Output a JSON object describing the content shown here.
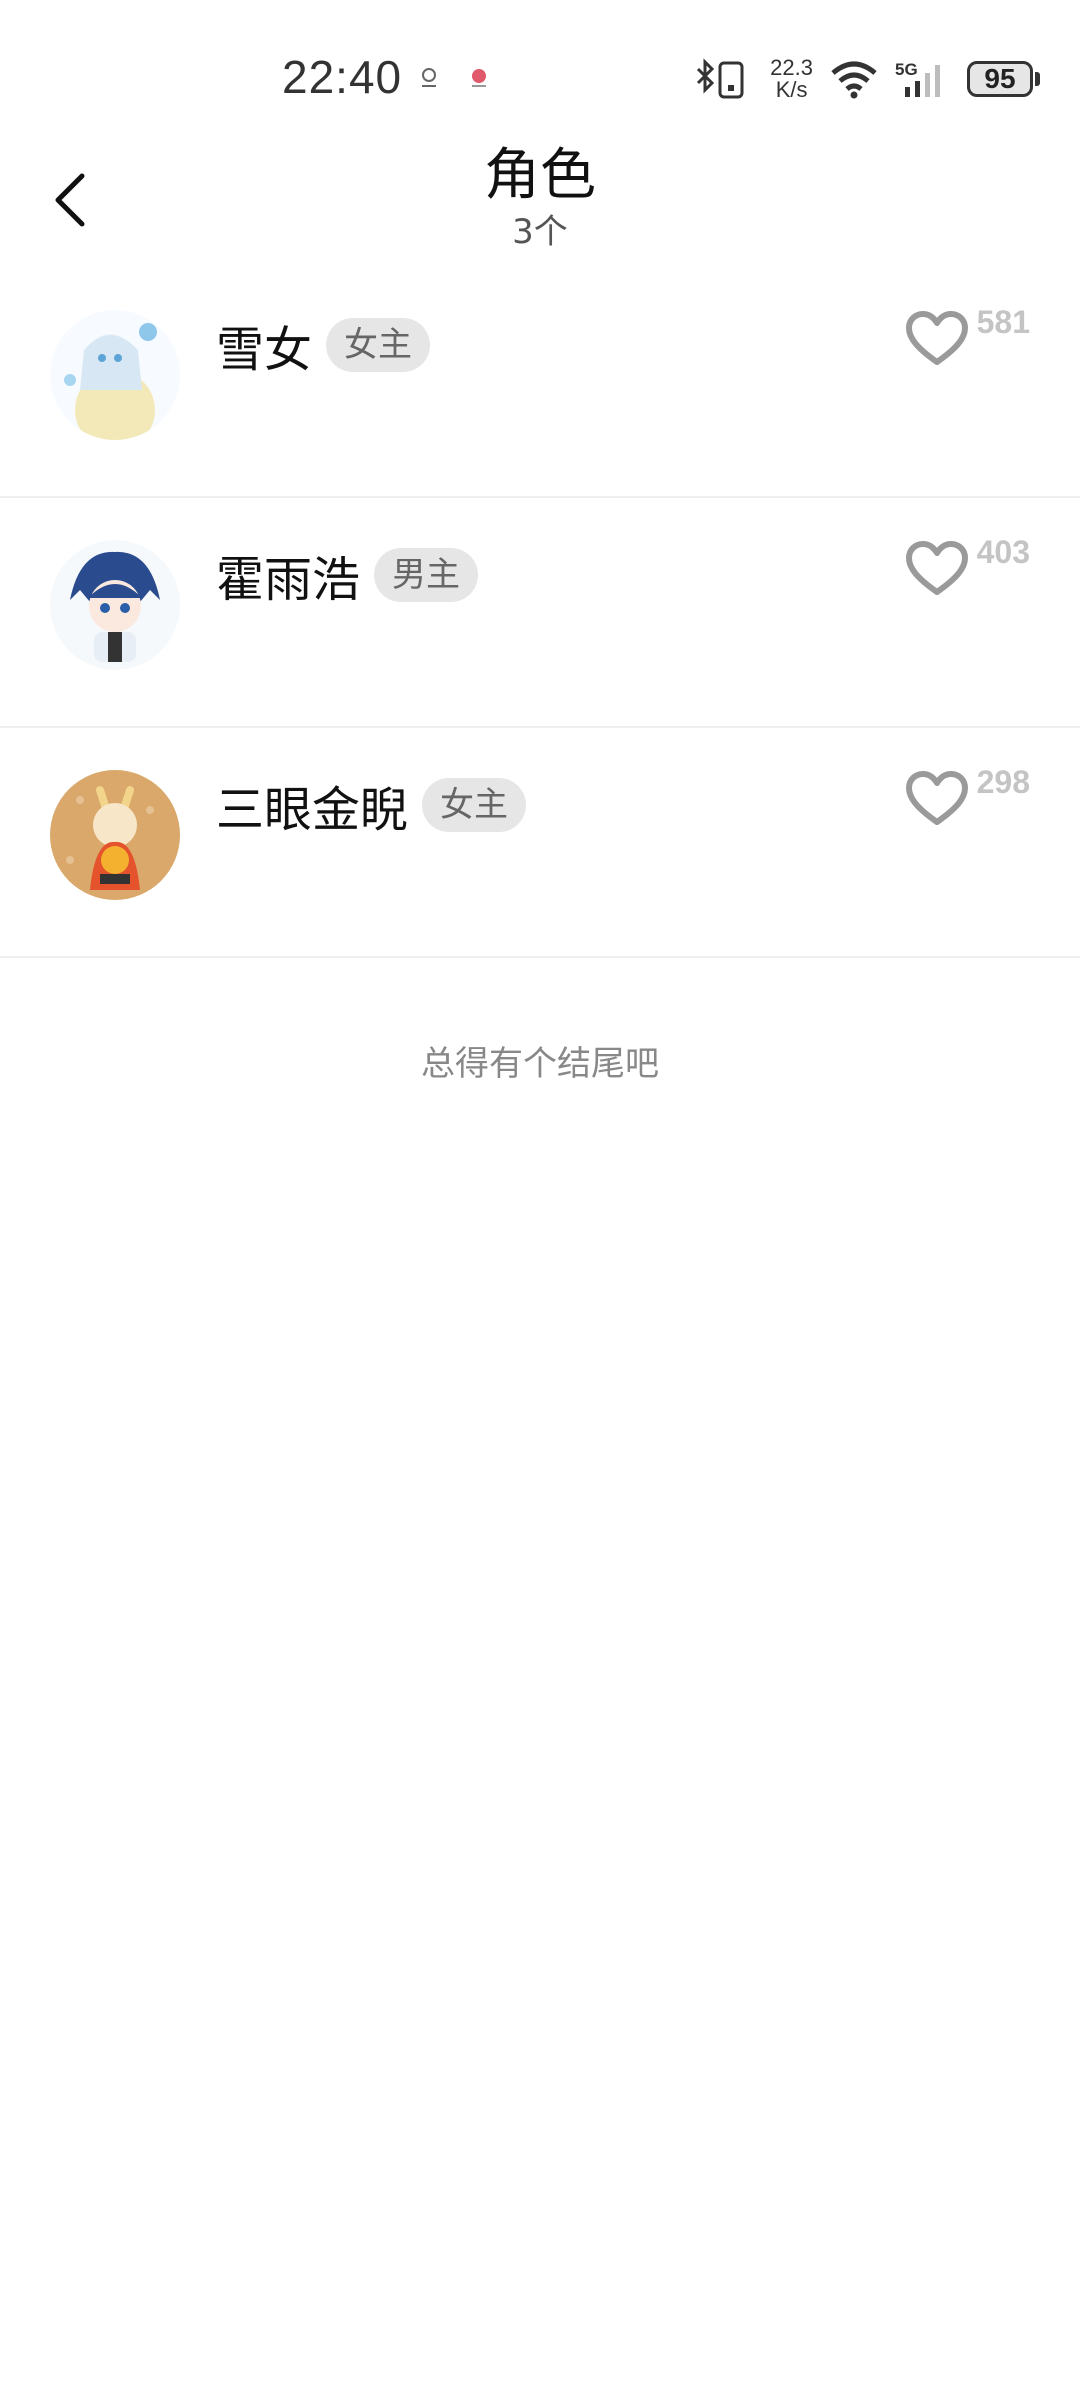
{
  "status_bar": {
    "time": "22:40",
    "net_speed_value": "22.3",
    "net_speed_unit": "K/s",
    "network": "5G",
    "battery": "95"
  },
  "header": {
    "title": "角色",
    "subtitle": "3个"
  },
  "characters": [
    {
      "name": "雪女",
      "tag": "女主",
      "likes": "581",
      "avatar_colors": [
        "#cfe8f5",
        "#f3e9b8"
      ]
    },
    {
      "name": "霍雨浩",
      "tag": "男主",
      "likes": "403",
      "avatar_colors": [
        "#2a4c8f",
        "#e8eef5"
      ]
    },
    {
      "name": "三眼金睨",
      "tag": "女主",
      "likes": "298",
      "avatar_colors": [
        "#d9a86a",
        "#e4532b"
      ]
    }
  ],
  "footer_note": "总得有个结尾吧"
}
